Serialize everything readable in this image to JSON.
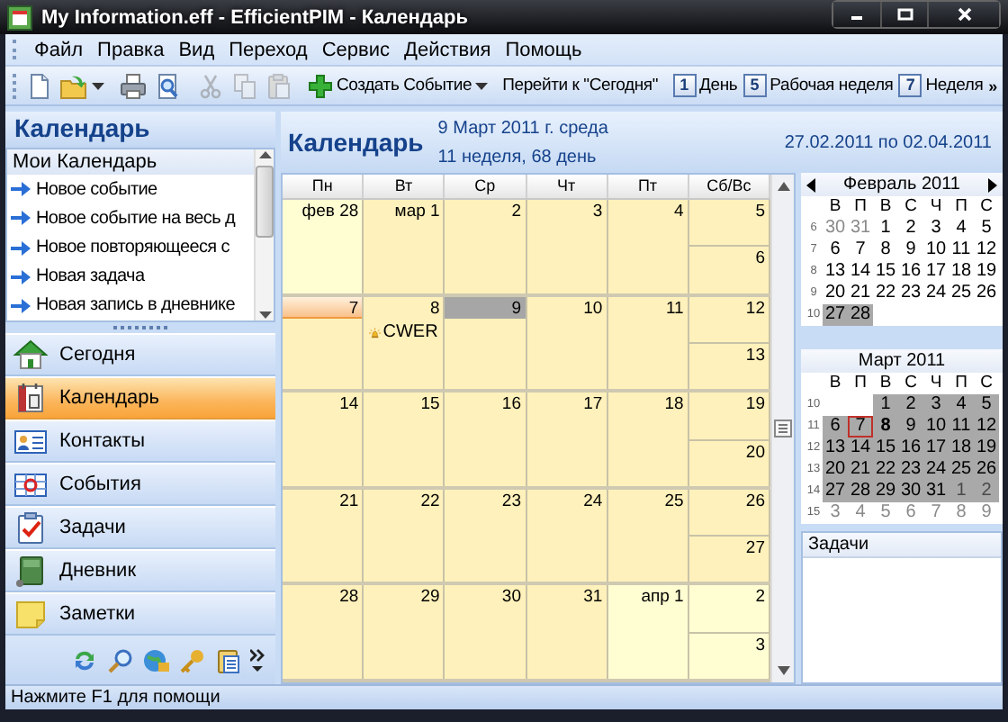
{
  "window": {
    "title": "My Information.eff - EfficientPIM - Календарь"
  },
  "menu": [
    "Файл",
    "Правка",
    "Вид",
    "Переход",
    "Сервис",
    "Действия",
    "Помощь"
  ],
  "toolbar": [
    {
      "kind": "icon",
      "disabled": false,
      "dropdown": false
    },
    {
      "kind": "icon",
      "disabled": false,
      "dropdown": true
    },
    {
      "kind": "separator"
    },
    {
      "kind": "icon",
      "disabled": false,
      "dropdown": false
    },
    {
      "kind": "icon",
      "disabled": false,
      "dropdown": false
    },
    {
      "kind": "separator"
    },
    {
      "kind": "icon",
      "disabled": true,
      "dropdown": false
    },
    {
      "kind": "icon",
      "disabled": true,
      "dropdown": false
    },
    {
      "kind": "icon",
      "disabled": true,
      "dropdown": false
    },
    {
      "kind": "separator"
    },
    {
      "kind": "button",
      "label": "Создать Событие",
      "dropdown": true
    },
    {
      "kind": "separator"
    },
    {
      "kind": "button",
      "label": "Перейти к \"Сегодня\"",
      "dropdown": false
    },
    {
      "kind": "separator"
    },
    {
      "kind": "view",
      "key": "1",
      "label": "День"
    },
    {
      "kind": "view",
      "key": "5",
      "label": "Рабочая неделя"
    },
    {
      "kind": "view",
      "key": "7",
      "label": "Неделя"
    },
    {
      "kind": "overflow",
      "label": "»"
    }
  ],
  "sidebar": {
    "title": "Календарь",
    "calendars": {
      "title": "Мои Календарь",
      "links": [
        "Новое событие",
        "Новое событие на весь д",
        "Новое повторяющееся с",
        "Новая задача",
        "Новая запись в дневнике"
      ]
    },
    "nav": [
      {
        "label": "Сегодня",
        "selected": false
      },
      {
        "label": "Календарь",
        "selected": true
      },
      {
        "label": "Контакты",
        "selected": false
      },
      {
        "label": "События",
        "selected": false
      },
      {
        "label": "Задачи",
        "selected": false
      },
      {
        "label": "Дневник",
        "selected": false
      },
      {
        "label": "Заметки",
        "selected": false
      }
    ]
  },
  "month_view": {
    "title": "Календарь",
    "date": "9 Март 2011 г. среда",
    "week_info": "11 неделя, 68 день",
    "range": "27.02.2011 по 02.04.2011",
    "weekdays": [
      "Пн",
      "Вт",
      "Ср",
      "Чт",
      "Пт",
      "Сб/Вс"
    ],
    "weeks": [
      {
        "days": [
          {
            "label": "фев 28",
            "other_month": true,
            "today": false,
            "selected": false
          },
          {
            "label": "мар 1",
            "other_month": false,
            "today": false,
            "selected": false
          },
          {
            "label": "2",
            "other_month": false,
            "today": false,
            "selected": false
          },
          {
            "label": "3",
            "other_month": false,
            "today": false,
            "selected": false
          },
          {
            "label": "4",
            "other_month": false,
            "today": false,
            "selected": false
          },
          {
            "label": "5",
            "other_month": false,
            "today": false,
            "selected": false
          },
          {
            "label": "6",
            "other_month": false,
            "today": false,
            "selected": false
          }
        ]
      },
      {
        "days": [
          {
            "label": "7",
            "other_month": false,
            "today": true,
            "selected": false
          },
          {
            "label": "8",
            "other_month": false,
            "today": false,
            "selected": false,
            "events": [
              {
                "title": "CWER"
              }
            ]
          },
          {
            "label": "9",
            "other_month": false,
            "today": false,
            "selected": true
          },
          {
            "label": "10",
            "other_month": false,
            "today": false,
            "selected": false
          },
          {
            "label": "11",
            "other_month": false,
            "today": false,
            "selected": false
          },
          {
            "label": "12",
            "other_month": false,
            "today": false,
            "selected": false
          },
          {
            "label": "13",
            "other_month": false,
            "today": false,
            "selected": false
          }
        ]
      },
      {
        "days": [
          {
            "label": "14",
            "other_month": false,
            "today": false,
            "selected": false
          },
          {
            "label": "15",
            "other_month": false,
            "today": false,
            "selected": false
          },
          {
            "label": "16",
            "other_month": false,
            "today": false,
            "selected": false
          },
          {
            "label": "17",
            "other_month": false,
            "today": false,
            "selected": false
          },
          {
            "label": "18",
            "other_month": false,
            "today": false,
            "selected": false
          },
          {
            "label": "19",
            "other_month": false,
            "today": false,
            "selected": false
          },
          {
            "label": "20",
            "other_month": false,
            "today": false,
            "selected": false
          }
        ]
      },
      {
        "days": [
          {
            "label": "21",
            "other_month": false,
            "today": false,
            "selected": false
          },
          {
            "label": "22",
            "other_month": false,
            "today": false,
            "selected": false
          },
          {
            "label": "23",
            "other_month": false,
            "today": false,
            "selected": false
          },
          {
            "label": "24",
            "other_month": false,
            "today": false,
            "selected": false
          },
          {
            "label": "25",
            "other_month": false,
            "today": false,
            "selected": false
          },
          {
            "label": "26",
            "other_month": false,
            "today": false,
            "selected": false
          },
          {
            "label": "27",
            "other_month": false,
            "today": false,
            "selected": false
          }
        ]
      },
      {
        "days": [
          {
            "label": "28",
            "other_month": false,
            "today": false,
            "selected": false
          },
          {
            "label": "29",
            "other_month": false,
            "today": false,
            "selected": false
          },
          {
            "label": "30",
            "other_month": false,
            "today": false,
            "selected": false
          },
          {
            "label": "31",
            "other_month": false,
            "today": false,
            "selected": false
          },
          {
            "label": "апр 1",
            "other_month": true,
            "today": false,
            "selected": false
          },
          {
            "label": "2",
            "other_month": true,
            "today": false,
            "selected": false
          },
          {
            "label": "3",
            "other_month": true,
            "today": false,
            "selected": false
          }
        ]
      }
    ]
  },
  "mini_calendars": [
    {
      "title": "Февраль 2011",
      "nav_arrows": true,
      "weekdays": [
        "В",
        "П",
        "В",
        "С",
        "Ч",
        "П",
        "С"
      ],
      "weeks": [
        {
          "number": "6",
          "days": [
            {
              "kind": "day",
              "label": "30",
              "other_month": true,
              "in_range": false,
              "today": false,
              "bold": false
            },
            {
              "kind": "day",
              "label": "31",
              "other_month": true,
              "in_range": false,
              "today": false,
              "bold": false
            },
            {
              "kind": "day",
              "label": "1",
              "other_month": false,
              "in_range": false,
              "today": false,
              "bold": false
            },
            {
              "kind": "day",
              "label": "2",
              "other_month": false,
              "in_range": false,
              "today": false,
              "bold": false
            },
            {
              "kind": "day",
              "label": "3",
              "other_month": false,
              "in_range": false,
              "today": false,
              "bold": false
            },
            {
              "kind": "day",
              "label": "4",
              "other_month": false,
              "in_range": false,
              "today": false,
              "bold": false
            },
            {
              "kind": "day",
              "label": "5",
              "other_month": false,
              "in_range": false,
              "today": false,
              "bold": false
            }
          ]
        },
        {
          "number": "7",
          "days": [
            {
              "kind": "day",
              "label": "6",
              "other_month": false,
              "in_range": false,
              "today": false,
              "bold": false
            },
            {
              "kind": "day",
              "label": "7",
              "other_month": false,
              "in_range": false,
              "today": false,
              "bold": false
            },
            {
              "kind": "day",
              "label": "8",
              "other_month": false,
              "in_range": false,
              "today": false,
              "bold": false
            },
            {
              "kind": "day",
              "label": "9",
              "other_month": false,
              "in_range": false,
              "today": false,
              "bold": false
            },
            {
              "kind": "day",
              "label": "10",
              "other_month": false,
              "in_range": false,
              "today": false,
              "bold": false
            },
            {
              "kind": "day",
              "label": "11",
              "other_month": false,
              "in_range": false,
              "today": false,
              "bold": false
            },
            {
              "kind": "day",
              "label": "12",
              "other_month": false,
              "in_range": false,
              "today": false,
              "bold": false
            }
          ]
        },
        {
          "number": "8",
          "days": [
            {
              "kind": "day",
              "label": "13",
              "other_month": false,
              "in_range": false,
              "today": false,
              "bold": false
            },
            {
              "kind": "day",
              "label": "14",
              "other_month": false,
              "in_range": false,
              "today": false,
              "bold": false
            },
            {
              "kind": "day",
              "label": "15",
              "other_month": false,
              "in_range": false,
              "today": false,
              "bold": false
            },
            {
              "kind": "day",
              "label": "16",
              "other_month": false,
              "in_range": false,
              "today": false,
              "bold": false
            },
            {
              "kind": "day",
              "label": "17",
              "other_month": false,
              "in_range": false,
              "today": false,
              "bold": false
            },
            {
              "kind": "day",
              "label": "18",
              "other_month": false,
              "in_range": false,
              "today": false,
              "bold": false
            },
            {
              "kind": "day",
              "label": "19",
              "other_month": false,
              "in_range": false,
              "today": false,
              "bold": false
            }
          ]
        },
        {
          "number": "9",
          "days": [
            {
              "kind": "day",
              "label": "20",
              "other_month": false,
              "in_range": false,
              "today": false,
              "bold": false
            },
            {
              "kind": "day",
              "label": "21",
              "other_month": false,
              "in_range": false,
              "today": false,
              "bold": false
            },
            {
              "kind": "day",
              "label": "22",
              "other_month": false,
              "in_range": false,
              "today": false,
              "bold": false
            },
            {
              "kind": "day",
              "label": "23",
              "other_month": false,
              "in_range": false,
              "today": false,
              "bold": false
            },
            {
              "kind": "day",
              "label": "24",
              "other_month": false,
              "in_range": false,
              "today": false,
              "bold": false
            },
            {
              "kind": "day",
              "label": "25",
              "other_month": false,
              "in_range": false,
              "today": false,
              "bold": false
            },
            {
              "kind": "day",
              "label": "26",
              "other_month": false,
              "in_range": false,
              "today": false,
              "bold": false
            }
          ]
        },
        {
          "number": "10",
          "days": [
            {
              "kind": "day",
              "label": "27",
              "other_month": false,
              "in_range": true,
              "today": false,
              "bold": false
            },
            {
              "kind": "day",
              "label": "28",
              "other_month": false,
              "in_range": true,
              "today": false,
              "bold": false
            }
          ]
        }
      ]
    },
    {
      "title": "Март 2011",
      "nav_arrows": false,
      "weekdays": [
        "В",
        "П",
        "В",
        "С",
        "Ч",
        "П",
        "С"
      ],
      "weeks": [
        {
          "number": "10",
          "days": [
            {
              "kind": "blank"
            },
            {
              "kind": "blank"
            },
            {
              "kind": "day",
              "label": "1",
              "other_month": false,
              "in_range": true,
              "today": false,
              "bold": false
            },
            {
              "kind": "day",
              "label": "2",
              "other_month": false,
              "in_range": true,
              "today": false,
              "bold": false
            },
            {
              "kind": "day",
              "label": "3",
              "other_month": false,
              "in_range": true,
              "today": false,
              "bold": false
            },
            {
              "kind": "day",
              "label": "4",
              "other_month": false,
              "in_range": true,
              "today": false,
              "bold": false
            },
            {
              "kind": "day",
              "label": "5",
              "other_month": false,
              "in_range": true,
              "today": false,
              "bold": false
            }
          ]
        },
        {
          "number": "11",
          "days": [
            {
              "kind": "day",
              "label": "6",
              "other_month": false,
              "in_range": true,
              "today": false,
              "bold": false
            },
            {
              "kind": "day",
              "label": "7",
              "other_month": false,
              "in_range": true,
              "today": true,
              "bold": false
            },
            {
              "kind": "day",
              "label": "8",
              "other_month": false,
              "in_range": true,
              "today": false,
              "bold": true
            },
            {
              "kind": "day",
              "label": "9",
              "other_month": false,
              "in_range": true,
              "today": false,
              "bold": false
            },
            {
              "kind": "day",
              "label": "10",
              "other_month": false,
              "in_range": true,
              "today": false,
              "bold": false
            },
            {
              "kind": "day",
              "label": "11",
              "other_month": false,
              "in_range": true,
              "today": false,
              "bold": false
            },
            {
              "kind": "day",
              "label": "12",
              "other_month": false,
              "in_range": true,
              "today": false,
              "bold": false
            }
          ]
        },
        {
          "number": "12",
          "days": [
            {
              "kind": "day",
              "label": "13",
              "other_month": false,
              "in_range": true,
              "today": false,
              "bold": false
            },
            {
              "kind": "day",
              "label": "14",
              "other_month": false,
              "in_range": true,
              "today": false,
              "bold": false
            },
            {
              "kind": "day",
              "label": "15",
              "other_month": false,
              "in_range": true,
              "today": false,
              "bold": false
            },
            {
              "kind": "day",
              "label": "16",
              "other_month": false,
              "in_range": true,
              "today": false,
              "bold": false
            },
            {
              "kind": "day",
              "label": "17",
              "other_month": false,
              "in_range": true,
              "today": false,
              "bold": false
            },
            {
              "kind": "day",
              "label": "18",
              "other_month": false,
              "in_range": true,
              "today": false,
              "bold": false
            },
            {
              "kind": "day",
              "label": "19",
              "other_month": false,
              "in_range": true,
              "today": false,
              "bold": false
            }
          ]
        },
        {
          "number": "13",
          "days": [
            {
              "kind": "day",
              "label": "20",
              "other_month": false,
              "in_range": true,
              "today": false,
              "bold": false
            },
            {
              "kind": "day",
              "label": "21",
              "other_month": false,
              "in_range": true,
              "today": false,
              "bold": false
            },
            {
              "kind": "day",
              "label": "22",
              "other_month": false,
              "in_range": true,
              "today": false,
              "bold": false
            },
            {
              "kind": "day",
              "label": "23",
              "other_month": false,
              "in_range": true,
              "today": false,
              "bold": false
            },
            {
              "kind": "day",
              "label": "24",
              "other_month": false,
              "in_range": true,
              "today": false,
              "bold": false
            },
            {
              "kind": "day",
              "label": "25",
              "other_month": false,
              "in_range": true,
              "today": false,
              "bold": false
            },
            {
              "kind": "day",
              "label": "26",
              "other_month": false,
              "in_range": true,
              "today": false,
              "bold": false
            }
          ]
        },
        {
          "number": "14",
          "days": [
            {
              "kind": "day",
              "label": "27",
              "other_month": false,
              "in_range": true,
              "today": false,
              "bold": false
            },
            {
              "kind": "day",
              "label": "28",
              "other_month": false,
              "in_range": true,
              "today": false,
              "bold": false
            },
            {
              "kind": "day",
              "label": "29",
              "other_month": false,
              "in_range": true,
              "today": false,
              "bold": false
            },
            {
              "kind": "day",
              "label": "30",
              "other_month": false,
              "in_range": true,
              "today": false,
              "bold": false
            },
            {
              "kind": "day",
              "label": "31",
              "other_month": false,
              "in_range": true,
              "today": false,
              "bold": false
            },
            {
              "kind": "day",
              "label": "1",
              "other_month": true,
              "in_range": true,
              "today": false,
              "bold": false
            },
            {
              "kind": "day",
              "label": "2",
              "other_month": true,
              "in_range": true,
              "today": false,
              "bold": false
            }
          ]
        },
        {
          "number": "15",
          "days": [
            {
              "kind": "day",
              "label": "3",
              "other_month": true,
              "in_range": false,
              "today": false,
              "bold": false
            },
            {
              "kind": "day",
              "label": "4",
              "other_month": true,
              "in_range": false,
              "today": false,
              "bold": false
            },
            {
              "kind": "day",
              "label": "5",
              "other_month": true,
              "in_range": false,
              "today": false,
              "bold": false
            },
            {
              "kind": "day",
              "label": "6",
              "other_month": true,
              "in_range": false,
              "today": false,
              "bold": false
            },
            {
              "kind": "day",
              "label": "7",
              "other_month": true,
              "in_range": false,
              "today": false,
              "bold": false
            },
            {
              "kind": "day",
              "label": "8",
              "other_month": true,
              "in_range": false,
              "today": false,
              "bold": false
            },
            {
              "kind": "day",
              "label": "9",
              "other_month": true,
              "in_range": false,
              "today": false,
              "bold": false
            }
          ]
        }
      ]
    }
  ],
  "tasks": {
    "title": "Задачи"
  },
  "status_bar": "Нажмите F1 для помощи"
}
